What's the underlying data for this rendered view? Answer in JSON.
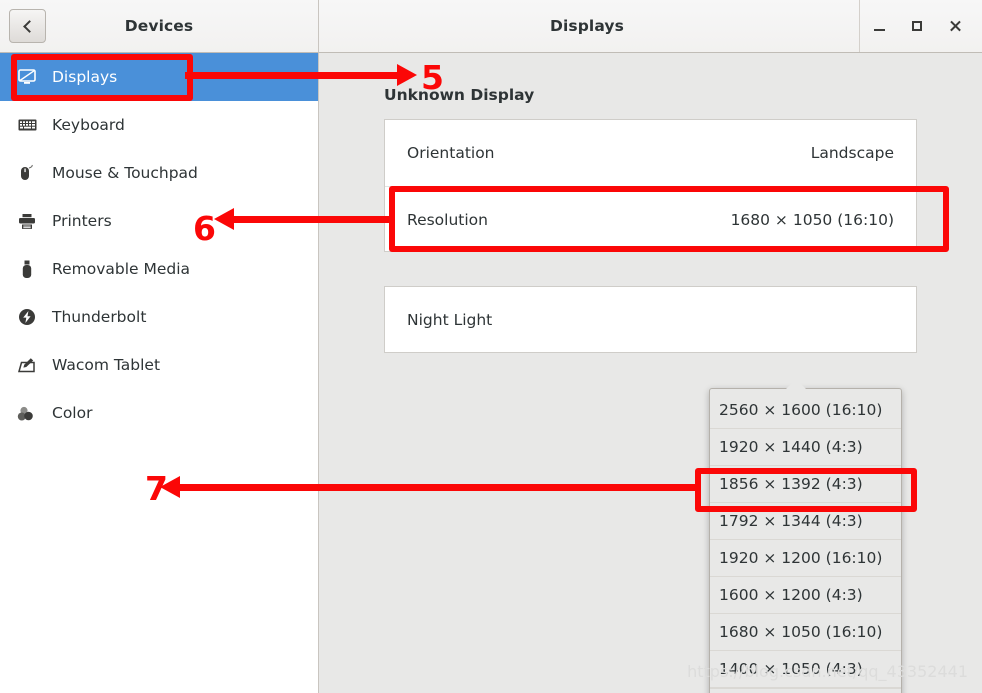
{
  "window": {
    "sidebar_title": "Devices",
    "main_title": "Displays",
    "back_label": "Back",
    "controls": {
      "minimize": "Minimize",
      "maximize": "Maximize",
      "close": "Close"
    }
  },
  "sidebar": {
    "items": [
      {
        "label": "Displays",
        "icon": "display-icon",
        "selected": true
      },
      {
        "label": "Keyboard",
        "icon": "keyboard-icon",
        "selected": false
      },
      {
        "label": "Mouse & Touchpad",
        "icon": "mouse-icon",
        "selected": false
      },
      {
        "label": "Printers",
        "icon": "printer-icon",
        "selected": false
      },
      {
        "label": "Removable Media",
        "icon": "usb-drive-icon",
        "selected": false
      },
      {
        "label": "Thunderbolt",
        "icon": "thunderbolt-icon",
        "selected": false
      },
      {
        "label": "Wacom Tablet",
        "icon": "wacom-tablet-icon",
        "selected": false
      },
      {
        "label": "Color",
        "icon": "color-icon",
        "selected": false
      }
    ]
  },
  "main": {
    "section_title": "Unknown Display",
    "rows": [
      {
        "label": "Orientation",
        "value": "Landscape"
      },
      {
        "label": "Resolution",
        "value": "1680 × 1050 (16:10)"
      }
    ],
    "night_light": {
      "label": "Night Light",
      "value": ""
    }
  },
  "dropdown": {
    "open": true,
    "selected_index": 6,
    "options": [
      "2560 × 1600 (16:10)",
      "1920 × 1440 (4:3)",
      "1856 × 1392 (4:3)",
      "1792 × 1344 (4:3)",
      "1920 × 1200 (16:10)",
      "1600 × 1200 (4:3)",
      "1680 × 1050 (16:10)",
      "1400 × 1050 (4:3)"
    ]
  },
  "annotations": {
    "color": "#fb0707",
    "steps": [
      {
        "number": "5",
        "target": "sidebar-item-displays"
      },
      {
        "number": "6",
        "target": "resolution-row"
      },
      {
        "number": "7",
        "target": "dropdown-option-1680x1050"
      }
    ]
  },
  "watermark": "https://blog.csdn.net/qq_43352441",
  "colors": {
    "selection_blue": "#4a90d9",
    "annotation_red": "#fb0707",
    "content_bg": "#e8e8e7",
    "card_bg": "#ffffff"
  }
}
